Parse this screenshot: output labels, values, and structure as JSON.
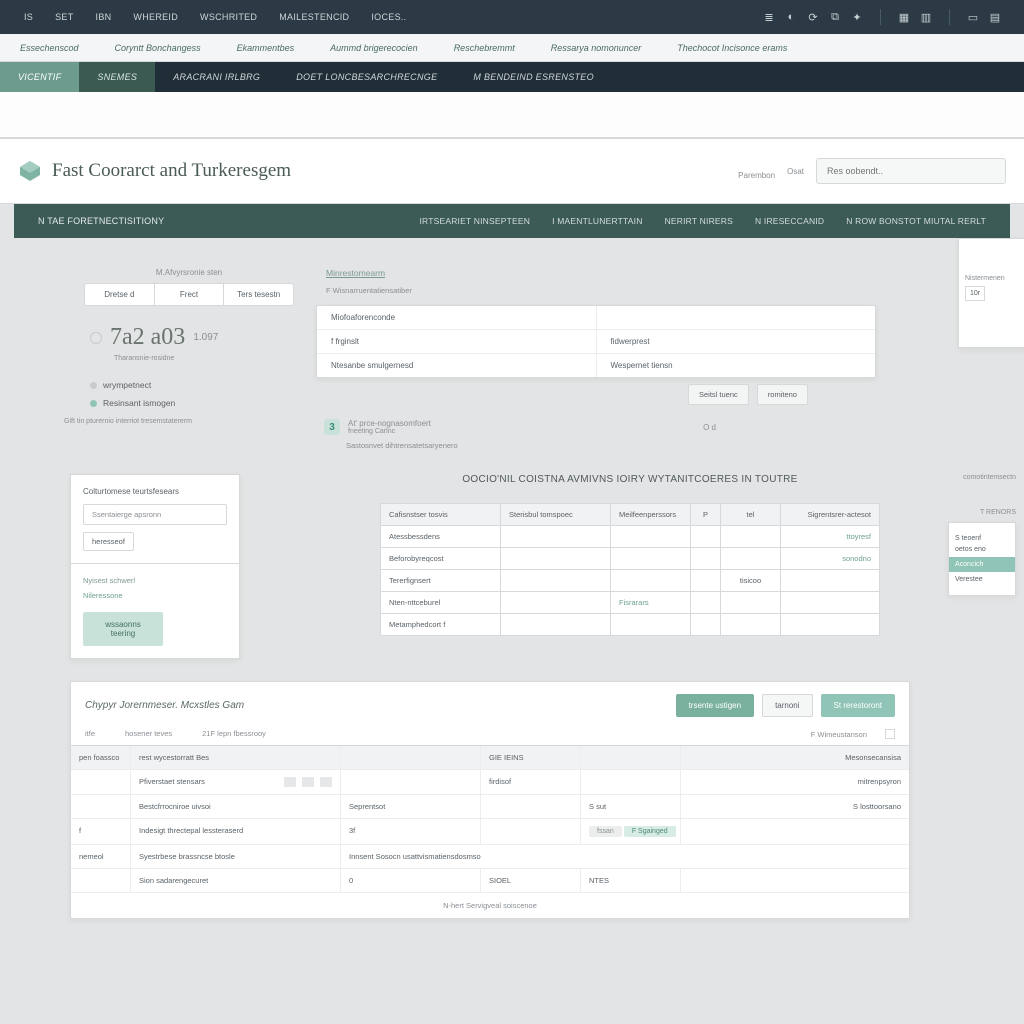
{
  "topnav": {
    "items": [
      "IS",
      "SET",
      "IBN",
      "WHEREID",
      "WSCHRITED",
      "MAILESTENCID",
      "IOCES.."
    ],
    "right_groups": [
      [
        "list-icon",
        "globe-icon",
        "refresh-icon",
        "tag-icon",
        "wand-icon"
      ],
      [
        "grid-icon",
        "panel-icon"
      ],
      [
        "window-icon",
        "layout-icon"
      ]
    ]
  },
  "subnav": {
    "items": [
      "Essechenscod",
      "Coryntt Bonchangess",
      "Ekammentbes",
      "Aummd brigerecocien",
      "Reschebremmt",
      "Ressarya nomonuncer",
      "Thechocot Incisonce erams"
    ]
  },
  "darktabs": {
    "items": [
      {
        "label": "Vicentif",
        "accent": "accent1"
      },
      {
        "label": "SNEMES",
        "accent": "accent2"
      },
      {
        "label": "ARACRANI IRLBrg",
        "accent": ""
      },
      {
        "label": "Doet loncbesarchrecnge",
        "accent": ""
      },
      {
        "label": "M Bendeind esrensteo",
        "accent": ""
      }
    ]
  },
  "title": {
    "text": "Fast Coorarct and Turkeresgem",
    "meta_top": "Parembon",
    "meta_left": "Osat",
    "search_placeholder": "Res oobendt.."
  },
  "context": {
    "left": "N TAE FORETNECTISITIONY",
    "tabs": [
      "IRTSEARIET NINSEPTEEN",
      "I MAENTLUNERTTAIN",
      "NERIRT NIRERS",
      "N IRESECCANID",
      "N ROW BONSTOT MIUTAL RERLT"
    ]
  },
  "summary": {
    "label": "M.Afvyrsronie sten",
    "segments": [
      "Dretse d",
      "Frect",
      "Ters tesestn"
    ],
    "value": "7a2 a03",
    "unit": "1.097",
    "sub": "Tharansnie-rosidne",
    "status1": "wrympetnect",
    "status2": "Resinsant ismogen",
    "hint": "Gift tin pturernio interriot tresemstatererm"
  },
  "center": {
    "heading": "Minrestomearm",
    "subhead": "F Wisnarruentatiensatiber",
    "rows": [
      [
        "Miofoaforenconde",
        ""
      ],
      [
        "f frginslt",
        "fidwerprest"
      ],
      [
        "Ntesanbe smulgernesd",
        "Wespernet tiensn"
      ]
    ],
    "btn1": "Seitsl tuenc",
    "btn2": "romiteno",
    "metric_badge": "3",
    "metric_text": "At' prce-nognasomfoert",
    "metric_sublabel": "fneeting Carlnc",
    "metric_right": "O d",
    "footnote": "Sastosnvet dihtrensatetsaryenero"
  },
  "peek": {
    "sub": "Nistermenen",
    "chip": "10r"
  },
  "widget": {
    "title": "Colturtomese teurtsfesears",
    "field": "Ssentaierge apsronn",
    "chip": "heresseof",
    "link1": "Nyisest schwerl",
    "link2": "Nileressone",
    "primary": "wssaonns teering"
  },
  "detail": {
    "title": "OOCIO'NIL COISTNA AVMIVNS IOIRY WYTANITCOERES IN TOUTRE",
    "head": [
      "Cafisnstser tosvis",
      "Sterisbul tomspoec",
      "Meilfeenperssors",
      "P",
      "tel",
      "Sigrentsrer-actesot"
    ],
    "rows": [
      [
        "Atessbessdens",
        "",
        "",
        "",
        "",
        "ttoyresf"
      ],
      [
        "Beforobyreqcost",
        "",
        "",
        "",
        "",
        "sonodno"
      ],
      [
        "Tererfignsert",
        "",
        "",
        "",
        "tisicoo",
        ""
      ],
      [
        "Nten-nttceburel",
        "",
        "Fisrarars",
        "",
        "",
        ""
      ],
      [
        "Metamphedcort f",
        "",
        "",
        "",
        "",
        ""
      ]
    ]
  },
  "peek2": {
    "tag": "comotintemsectn",
    "heading": "T RENORS",
    "lines": [
      "S teoenf",
      "oetos eno",
      "Verestee"
    ],
    "accent": "Aconcich"
  },
  "bottom": {
    "title": "Chypyr Jorernmeser. Mcxstles Gam",
    "btn_primary": "trsente ustigen",
    "btn_secondary": "tarnoni",
    "btn_accent": "St rerestoront",
    "sub_left": [
      "itfe",
      "hosener teves"
    ],
    "sub_mid": "21F  lepn fbessrooy",
    "sub_right_label": "F  Wimeustanson",
    "head": [
      "pen foassco",
      "rest wycestorratt Bes",
      "",
      "GIE IEINS",
      "",
      "Mesonsecansisa"
    ],
    "rows": [
      {
        "c1": "",
        "c2": "Pfiverstaet stensars",
        "c3": "",
        "c4": "firdisof",
        "c5": "",
        "c6": "mitrenpsyron",
        "icons": true
      },
      {
        "c1": "",
        "c2": "Bestcfrrocniroe uivsoi",
        "c3": "Seprentsot",
        "c4": "",
        "c5": "S sut",
        "c6": "S losttoorsano",
        "icons": false
      },
      {
        "c1": "f",
        "c2": "Indesigt threctepal lessteraserd",
        "c3": "3f",
        "c4": "",
        "c5_badge_gray": "fssan",
        "c5_badge_green": "F Sgainged",
        "c6": "",
        "icons": false
      },
      {
        "c1": "nemeol",
        "c2": "Syestrbese brassncse btosle",
        "c3": "Innsent Sosocn usattvismatiensdosmso",
        "c4": "",
        "c5": "",
        "c6": "",
        "icons": false,
        "merged": true
      },
      {
        "c1": "",
        "c2": "Sion sadarengecuret",
        "c3": "0",
        "c4": "SIOEL",
        "c5": "NTES",
        "c6": "",
        "icons": false
      }
    ],
    "footer": "N-hert Servigveal soiscenoe"
  }
}
